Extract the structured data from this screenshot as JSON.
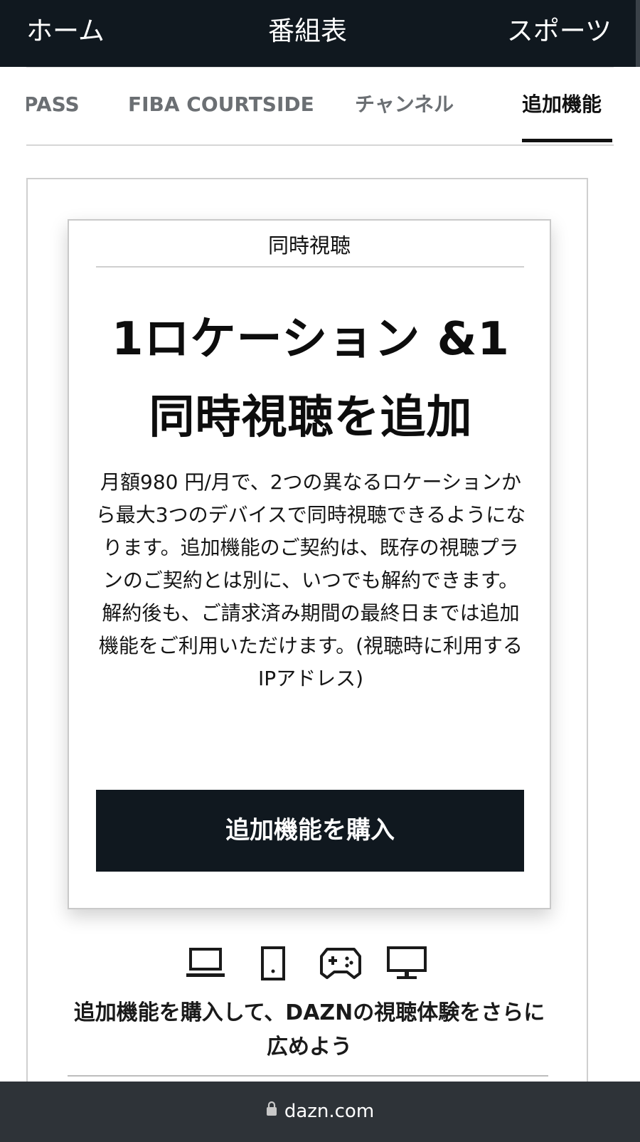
{
  "top_nav": {
    "home": "ホーム",
    "schedule": "番組表",
    "sports": "スポーツ"
  },
  "tabs": [
    {
      "label": "PASS",
      "active": false
    },
    {
      "label": "FIBA COURTSIDE",
      "active": false
    },
    {
      "label": "チャンネル",
      "active": false
    },
    {
      "label": "追加機能",
      "active": true
    }
  ],
  "card": {
    "label": "同時視聴",
    "title_line1": "1ロケーション &1",
    "title_line2": "同時視聴を追加",
    "description": "月額980 円/月で、2つの異なるロケーションから最大3つのデバイスで同時視聴できるようになります。追加機能のご契約は、既存の視聴プランのご契約とは別に、いつでも解約できます。解約後も、ご請求済み期間の最終日までは追加機能をご利用いただけます。(視聴時に利用するIPアドレス)",
    "button_label": "追加機能を購入"
  },
  "devices": {
    "icons": [
      "laptop-icon",
      "tablet-icon",
      "gamepad-icon",
      "tv-icon"
    ]
  },
  "promo_text": "追加機能を購入して、DAZNの視聴体験をさらに広めよう",
  "browser": {
    "url": "dazn.com",
    "lock_icon": "lock-icon"
  },
  "colors": {
    "nav_bg": "#10181f",
    "button_bg": "#10181f",
    "url_bar_bg": "#2e3338"
  }
}
